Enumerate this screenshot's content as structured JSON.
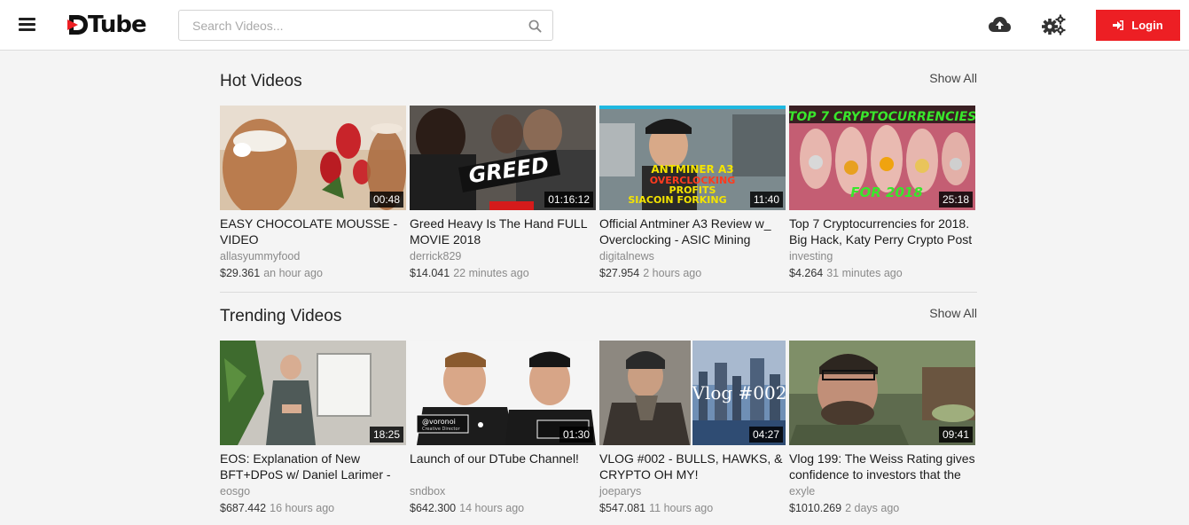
{
  "header": {
    "logo_text": "Tube",
    "search_placeholder": "Search Videos...",
    "login_label": "Login",
    "brand_color": "#ed1f24"
  },
  "icons": [
    "menu-icon",
    "search-icon",
    "cloud-upload-icon",
    "settings-cogs-icon",
    "sign-in-icon"
  ],
  "hot": {
    "title": "Hot Videos",
    "show_all": "Show All",
    "videos": [
      {
        "title": "EASY CHOCOLATE MOUSSE - VIDEO",
        "author": "allasyummyfood",
        "payout": "$29.361",
        "ago": "an hour ago",
        "duration": "00:48"
      },
      {
        "title": "Greed Heavy Is The Hand FULL MOVIE 2018",
        "author": "derrick829",
        "payout": "$14.041",
        "ago": "22 minutes ago",
        "duration": "01:16:12",
        "overlay": "GREED"
      },
      {
        "title": "Official Antminer A3 Review w_ Overclocking - ASIC Mining",
        "author": "digitalnews",
        "payout": "$27.954",
        "ago": "2 hours ago",
        "duration": "11:40",
        "overlay_1": "ANTMINER A3",
        "overlay_2": "OVERCLOCKING",
        "overlay_3": "PROFITS",
        "overlay_4": "SIACOIN FORKING"
      },
      {
        "title": "Top 7 Cryptocurrencies for 2018. Big Hack, Katy Perry Crypto Post",
        "author": "investing",
        "payout": "$4.264",
        "ago": "31 minutes ago",
        "duration": "25:18",
        "overlay_1": "TOP 7 CRYPTOCURRENCIES",
        "overlay_2": "FOR 2018"
      }
    ]
  },
  "trending": {
    "title": "Trending Videos",
    "show_all": "Show All",
    "videos": [
      {
        "title": "EOS: Explanation of New BFT+DPoS w/ Daniel Larimer -",
        "author": "eosgo",
        "payout": "$687.442",
        "ago": "16 hours ago",
        "duration": "18:25"
      },
      {
        "title": "Launch of our DTube Channel!",
        "author": "sndbox",
        "payout": "$642.300",
        "ago": "14 hours ago",
        "duration": "01:30",
        "overlay_1": "@voronoi",
        "overlay_2": "Creative Director"
      },
      {
        "title": "VLOG #002 - BULLS, HAWKS, & CRYPTO OH MY!",
        "author": "joeparys",
        "payout": "$547.081",
        "ago": "11 hours ago",
        "duration": "04:27",
        "overlay": "Vlog #002"
      },
      {
        "title": "Vlog 199: The Weiss Rating gives confidence to investors that the",
        "author": "exyle",
        "payout": "$1010.269",
        "ago": "2 days ago",
        "duration": "09:41"
      }
    ]
  }
}
